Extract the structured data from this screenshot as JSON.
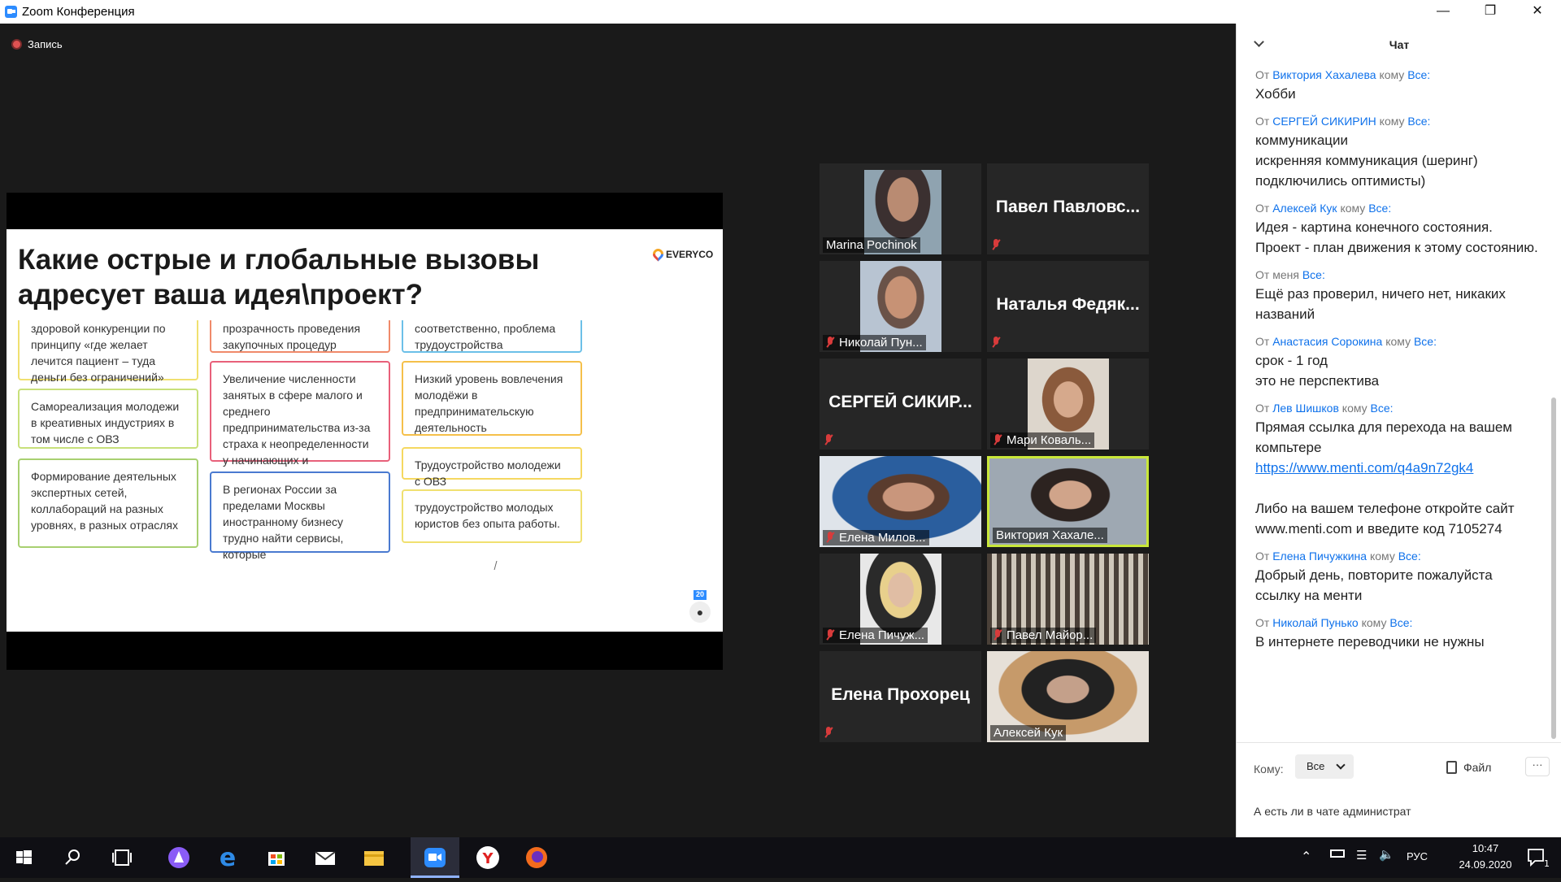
{
  "window": {
    "title": "Zoom Конференция"
  },
  "recording": {
    "label": "Запись"
  },
  "slide": {
    "title": "Какие острые и глобальные вызовы адресует ваша идея\\проект?",
    "logo": "EVERYCO",
    "cards": [
      {
        "text": "здоровой конкуренции по принципу «где желает лечится пациент – туда деньги без ограничений»",
        "color": "#f0e070"
      },
      {
        "text": "прозрачность проведения закупочных процедур",
        "color": "#f08a6a"
      },
      {
        "text": "соответственно, проблема трудоустройства",
        "color": "#6cc0e8"
      },
      {
        "text": "Самореализация молодежи в креативных индустриях в том числе с ОВЗ",
        "color": "#c8e07a"
      },
      {
        "text": "Увеличение численности занятых в сфере малого и среднего предпринимательства из-за страха к неопределенности у начинающих и действующих предпринимателей",
        "color": "#e8607a"
      },
      {
        "text": "Низкий уровень вовлечения молодёжи в предпринимательскую деятельность",
        "color": "#f5c04a"
      },
      {
        "text": "Трудоустройство молодежи с ОВЗ",
        "color": "#f5d860"
      },
      {
        "text": "Формирование деятельных экспертных сетей, коллабораций на разных уровнях, в разных отраслях",
        "color": "#a8d070"
      },
      {
        "text": "В регионах России за пределами Москвы иностранному бизнесу трудно найти сервисы, которые",
        "color": "#4a7ad0"
      },
      {
        "text": "трудоустройство молодых юристов без опыта работы.",
        "color": "#f0e070"
      }
    ],
    "badge": "20"
  },
  "participants": [
    {
      "name": "Marina Pochinok",
      "video": true,
      "muted": false,
      "active": false
    },
    {
      "name": "Павел Павловс...",
      "video": false,
      "muted": true,
      "active": false
    },
    {
      "name": "Николай Пун...",
      "video": true,
      "muted": true,
      "active": false
    },
    {
      "name": "Наталья Федяк...",
      "video": false,
      "muted": true,
      "active": false
    },
    {
      "name": "СЕРГЕЙ СИКИР...",
      "video": false,
      "muted": true,
      "active": false
    },
    {
      "name": "Мари Коваль...",
      "video": true,
      "muted": true,
      "active": false
    },
    {
      "name": "Елена Милов...",
      "video": true,
      "muted": true,
      "active": false
    },
    {
      "name": "Виктория Хахале...",
      "video": true,
      "muted": false,
      "active": true
    },
    {
      "name": "Елена Пичуж...",
      "video": true,
      "muted": true,
      "active": false
    },
    {
      "name": "Павел Майор...",
      "video": true,
      "muted": true,
      "active": false
    },
    {
      "name": "Елена Прохорец",
      "video": false,
      "muted": true,
      "active": false
    },
    {
      "name": "Алексей Кук",
      "video": true,
      "muted": false,
      "active": false
    }
  ],
  "chat": {
    "title": "Чат",
    "messages": [
      {
        "from": "Виктория Хахалева",
        "to": "Все:",
        "lines": [
          "Хобби"
        ]
      },
      {
        "from": "СЕРГЕЙ СИКИРИН",
        "to": "Все:",
        "lines": [
          "коммуникации",
          "искренняя коммуникация (шеринг)",
          "подключились оптимисты)"
        ]
      },
      {
        "from": "Алексей Кук",
        "to": "Все:",
        "lines": [
          "Идея - картина конечного состояния.",
          "Проект - план движения к этому состоянию."
        ]
      },
      {
        "from": "",
        "to": "Все:",
        "self": true,
        "lines": [
          "Ещё раз проверил, ничего нет, никаких названий"
        ]
      },
      {
        "from": "Анастасия Сорокина",
        "to": "Все:",
        "lines": [
          "срок - 1 год",
          "это не перспектива"
        ]
      },
      {
        "from": "Лев Шишков",
        "to": "Все:",
        "lines": [
          "Прямая ссылка для перехода на вашем компьтере"
        ],
        "link": "https://www.menti.com/q4a9n72gk4",
        "after": [
          "",
          "Либо на вашем телефоне откройте сайт www.menti.com и введите код 7105274"
        ]
      },
      {
        "from": "Елена Пичужкина",
        "to": "Все:",
        "lines": [
          "Добрый день, повторите пожалуйста ссылку на менти"
        ]
      },
      {
        "from": "Николай Пунько",
        "to": "Все:",
        "lines": [
          "В интернете переводчики не нужны"
        ]
      }
    ],
    "from_prefix": "От",
    "to_word": "кому",
    "self_label": "меня",
    "compose": {
      "to_label": "Кому:",
      "to_value": "Все",
      "file_label": "Файл",
      "more": "···",
      "draft": "А есть ли в чате администрат"
    }
  },
  "taskbar": {
    "lang": "РУС",
    "time": "10:47",
    "date": "24.09.2020",
    "notif": "1"
  }
}
